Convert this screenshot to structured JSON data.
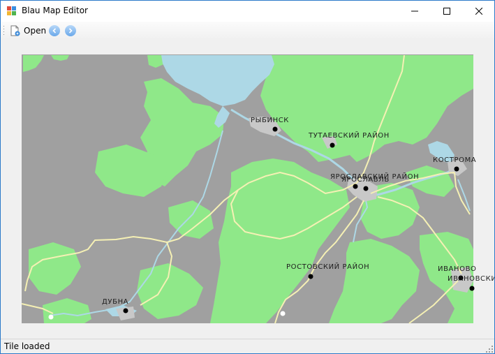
{
  "window": {
    "title": "Blau Map Editor",
    "minimize_icon": "minimize-icon",
    "maximize_icon": "maximize-icon",
    "close_icon": "close-icon"
  },
  "toolbar": {
    "open_label": "Open",
    "open_icon": "open-file-icon",
    "back_icon": "arrow-left-icon",
    "forward_icon": "arrow-right-icon"
  },
  "map": {
    "colors": {
      "land": "#a0a0a0",
      "forest": "#8fe889",
      "water": "#add8e6",
      "urban": "#c8c8c8",
      "road": "#f5f0b4"
    },
    "labels": {
      "rybinsk": "РЫБИНСК",
      "tutaevsky": "ТУТАЕВСКИЙ РАЙОН",
      "kostroma": "КОСТРОМА",
      "yaroslavsky": "ЯРОСЛАВСКИЙ РАЙОН",
      "yaroslavl": "ЯРОСЛАВЛЬ",
      "rostovsky": "РОСТОВСКИЙ РАЙОН",
      "ivanovo": "ИВАНОВО",
      "ivanovsky": "ИВАНОВСКИЙ",
      "dubna": "ДУБНА"
    }
  },
  "status": {
    "text": "Tile loaded"
  }
}
